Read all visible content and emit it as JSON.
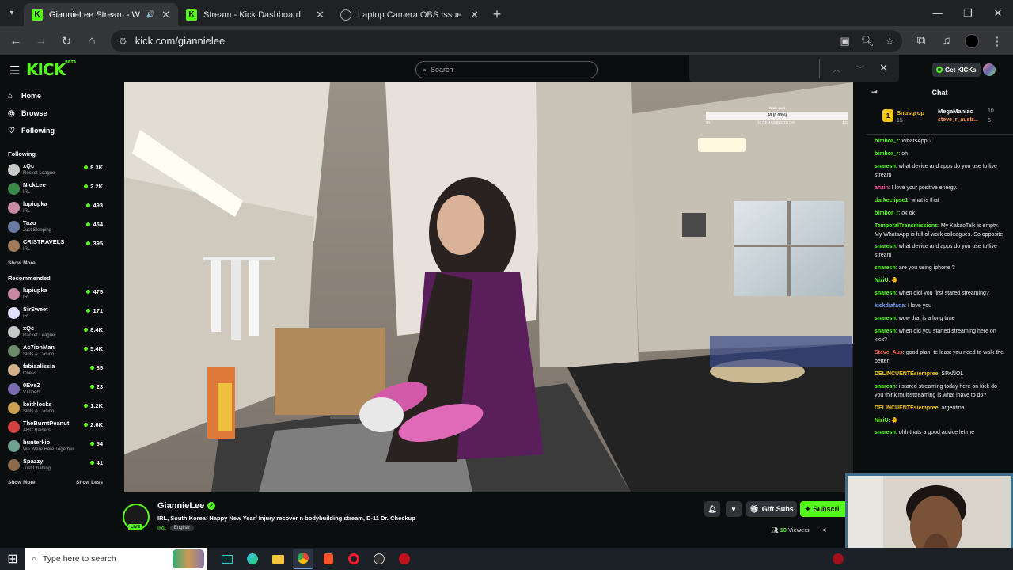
{
  "browser": {
    "tabs": [
      {
        "title": "GiannieLee Stream - Watch Live o",
        "active": true
      },
      {
        "title": "Stream - Kick Dashboard",
        "active": false
      },
      {
        "title": "Laptop Camera OBS Issue",
        "active": false
      }
    ],
    "url": "kick.com/giannielee"
  },
  "kick": {
    "logo": "KICK",
    "logo_badge": "BETA",
    "search_placeholder": "Search",
    "get_kicks": "Get KICKs"
  },
  "sidebar": {
    "nav": [
      {
        "label": "Home",
        "icon": "home-icon"
      },
      {
        "label": "Browse",
        "icon": "compass-icon"
      },
      {
        "label": "Following",
        "icon": "heart-icon"
      }
    ],
    "following_title": "Following",
    "following": [
      {
        "name": "xQc",
        "category": "Rocket League",
        "viewers": "8.3K",
        "color": "#c9c9c9"
      },
      {
        "name": "NickLee",
        "category": "IRL",
        "viewers": "2.2K",
        "color": "#3a8a4a"
      },
      {
        "name": "lupiupka",
        "category": "IRL",
        "viewers": "493",
        "color": "#c88aa0"
      },
      {
        "name": "Tazo",
        "category": "Just Sleeping",
        "viewers": "454",
        "color": "#6a7aa0"
      },
      {
        "name": "CRISTRAVELS",
        "category": "IRL",
        "viewers": "395",
        "color": "#a07a5a"
      }
    ],
    "show_more": "Show More",
    "recommended_title": "Recommended",
    "recommended": [
      {
        "name": "lupiupka",
        "category": "IRL",
        "viewers": "475",
        "color": "#c88aa0"
      },
      {
        "name": "SirSweet",
        "category": "IRL",
        "viewers": "171",
        "color": "#e0e0ff"
      },
      {
        "name": "xQc",
        "category": "Rocket League",
        "viewers": "8.4K",
        "color": "#c9c9c9"
      },
      {
        "name": "Ac7ionMan",
        "category": "Slots & Casino",
        "viewers": "5.4K",
        "color": "#6a8a6a"
      },
      {
        "name": "fabiaalissia",
        "category": "Chess",
        "viewers": "85",
        "color": "#d4b08a"
      },
      {
        "name": "0EveZ",
        "category": "VTubers",
        "viewers": "23",
        "color": "#7a6ab0"
      },
      {
        "name": "keithlocks",
        "category": "Slots & Casino",
        "viewers": "1.2K",
        "color": "#c8a050"
      },
      {
        "name": "TheBurntPeanut",
        "category": "ARC Raiders",
        "viewers": "2.6K",
        "color": "#d04040"
      },
      {
        "name": "hunterkio",
        "category": "We Were Here Together",
        "viewers": "54",
        "color": "#70a090"
      },
      {
        "name": "Spazzy",
        "category": "Just Chatting",
        "viewers": "41",
        "color": "#8a6a4a"
      }
    ],
    "show_more2": "Show More",
    "show_less": "Show Less"
  },
  "video": {
    "goal_title": "Daily goal",
    "goal_value": "$0 (0.00%)",
    "goal_min": "$0",
    "goal_max": "$10",
    "goal_sub": "10 REMAINING TO GO",
    "goal_fraction": 0.0
  },
  "stream": {
    "name": "GiannieLee",
    "title": "IRL, South Korea: Happy New Year/ Injury recover n bodybuilding stream, D-11 Dr. Checkup",
    "category": "IRL",
    "language": "English",
    "live_label": "LIVE",
    "gift_subs": "Gift Subs",
    "subscribe": "Subscri",
    "viewers": "10",
    "viewers_label": "Viewers"
  },
  "chat": {
    "title": "Chat",
    "pinned": [
      {
        "user": "Snusgrop",
        "count": "15",
        "rank": "1"
      },
      {
        "user": "MegaManiac",
        "count": "10"
      },
      {
        "user": "steve_r_austr...",
        "count": "5"
      }
    ],
    "messages": [
      {
        "user": "bimbor_r",
        "text": "WhatsApp ?",
        "color": "#53fc18"
      },
      {
        "user": "bimbor_r",
        "text": "oh",
        "color": "#53fc18"
      },
      {
        "user": "snaresh",
        "text": "what device and apps do you use to live stream",
        "color": "#53fc18"
      },
      {
        "user": "ahzin",
        "text": "I love your positive energy.",
        "color": "#ff5aa0"
      },
      {
        "user": "darkeclipse1",
        "text": "what is that",
        "color": "#53fc18"
      },
      {
        "user": "bimbor_r",
        "text": "ok ok",
        "color": "#53fc18"
      },
      {
        "user": "TemporalTransmissions",
        "text": "My KakaoTalk is empty. My WhatsApp is full of work colleagues. So opposite",
        "color": "#53fc18"
      },
      {
        "user": "snaresh",
        "text": "what device and apps do you use to live stream",
        "color": "#53fc18"
      },
      {
        "user": "snaresh",
        "text": "are you using iphone ?",
        "color": "#53fc18"
      },
      {
        "user": "NiziU",
        "text": "🐥",
        "color": "#53fc18"
      },
      {
        "user": "snaresh",
        "text": "when didi you first stared streaming?",
        "color": "#53fc18"
      },
      {
        "user": "kickdiafada",
        "text": "I love you",
        "color": "#7aa3ff"
      },
      {
        "user": "snaresh",
        "text": "wow that is a long time",
        "color": "#53fc18"
      },
      {
        "user": "snaresh",
        "text": "when did you started streaming here on kick?",
        "color": "#53fc18"
      },
      {
        "user": "Steve_Aus",
        "text": "good plan, te least you need to walk the better",
        "color": "#ff6a4a"
      },
      {
        "user": "DELINCUENTEsiempree",
        "text": "SPAÑOL",
        "color": "#f5c518"
      },
      {
        "user": "snaresh",
        "text": "i stared streaming today here on kick do you think multisttreaming is what ihave to do?",
        "color": "#53fc18"
      },
      {
        "user": "DELINCUENTEsiempree",
        "text": "argentina",
        "color": "#f5c518"
      },
      {
        "user": "NiziU",
        "text": "🐥",
        "color": "#53fc18"
      },
      {
        "user": "snaresh",
        "text": "ohh thats a good advice let me",
        "color": "#53fc18"
      }
    ]
  },
  "taskbar": {
    "search_placeholder": "Type here to search"
  }
}
